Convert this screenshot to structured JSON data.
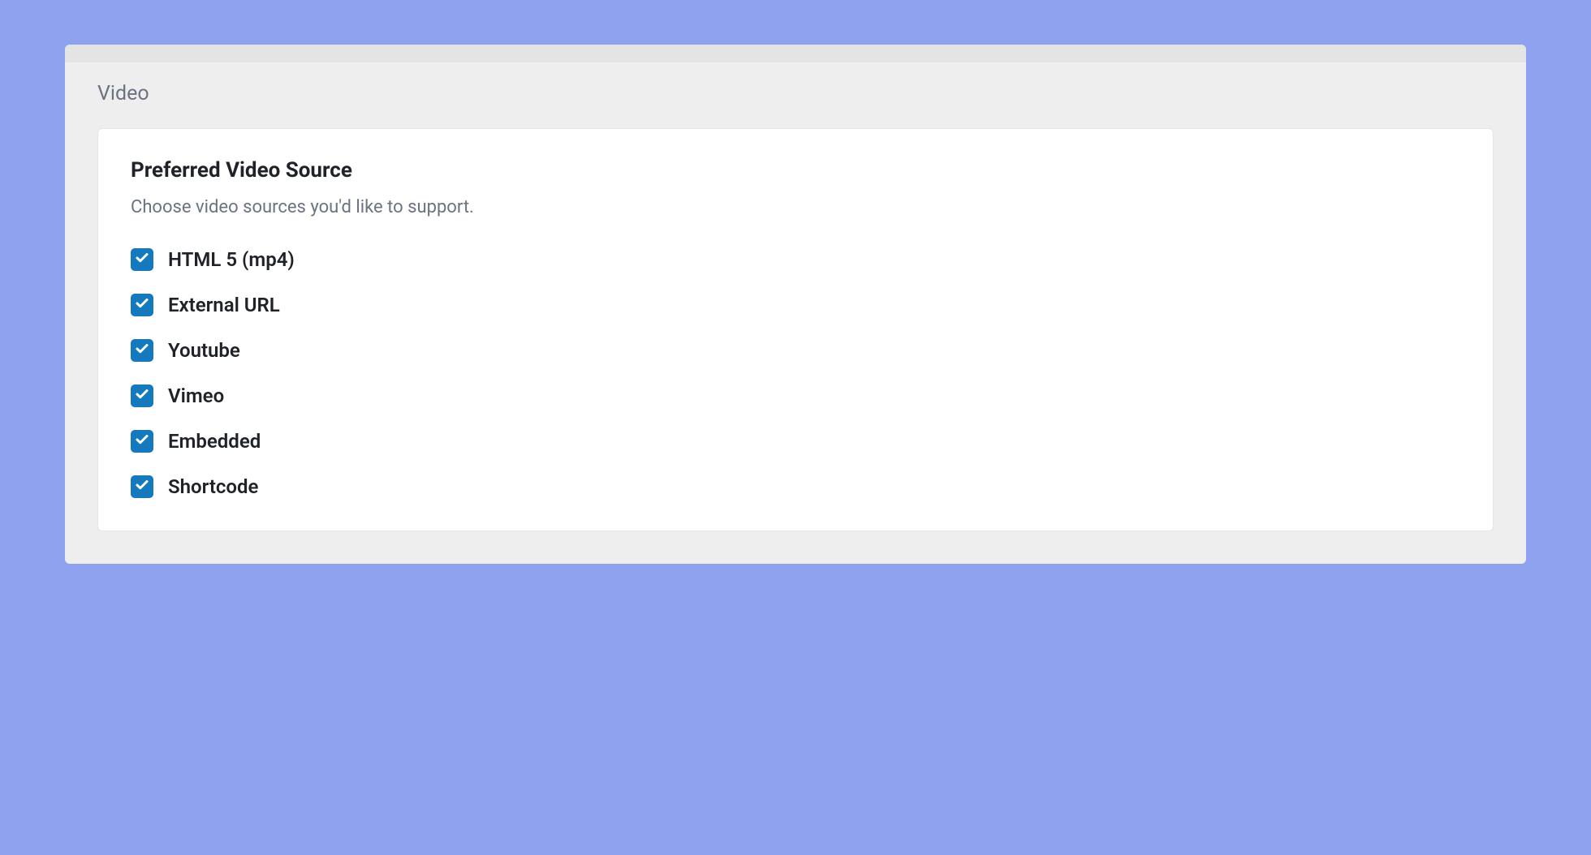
{
  "section": {
    "title": "Video"
  },
  "card": {
    "title": "Preferred Video Source",
    "description": "Choose video sources you'd like to support."
  },
  "options": [
    {
      "key": "html5",
      "label": "HTML 5 (mp4)",
      "checked": true
    },
    {
      "key": "external-url",
      "label": "External URL",
      "checked": true
    },
    {
      "key": "youtube",
      "label": "Youtube",
      "checked": true
    },
    {
      "key": "vimeo",
      "label": "Vimeo",
      "checked": true
    },
    {
      "key": "embedded",
      "label": "Embedded",
      "checked": true
    },
    {
      "key": "shortcode",
      "label": "Shortcode",
      "checked": true
    }
  ]
}
